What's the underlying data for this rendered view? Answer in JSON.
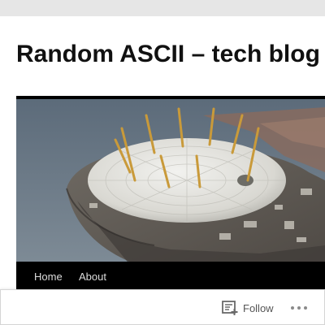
{
  "site": {
    "title": "Random ASCII – tech blog"
  },
  "header_image": {
    "description_icon": "dome-aerial-photo"
  },
  "nav": {
    "items": [
      {
        "label": "Home"
      },
      {
        "label": "About"
      }
    ]
  },
  "follow_bar": {
    "follow_label": "Follow",
    "follow_icon": "reader-follow-icon",
    "more_icon": "ellipsis-icon"
  },
  "colors": {
    "nav_background": "#000000",
    "nav_text": "#dddddd",
    "title_text": "#111111",
    "page_background": "#ffffff",
    "outer_background": "#e6e6e6"
  }
}
